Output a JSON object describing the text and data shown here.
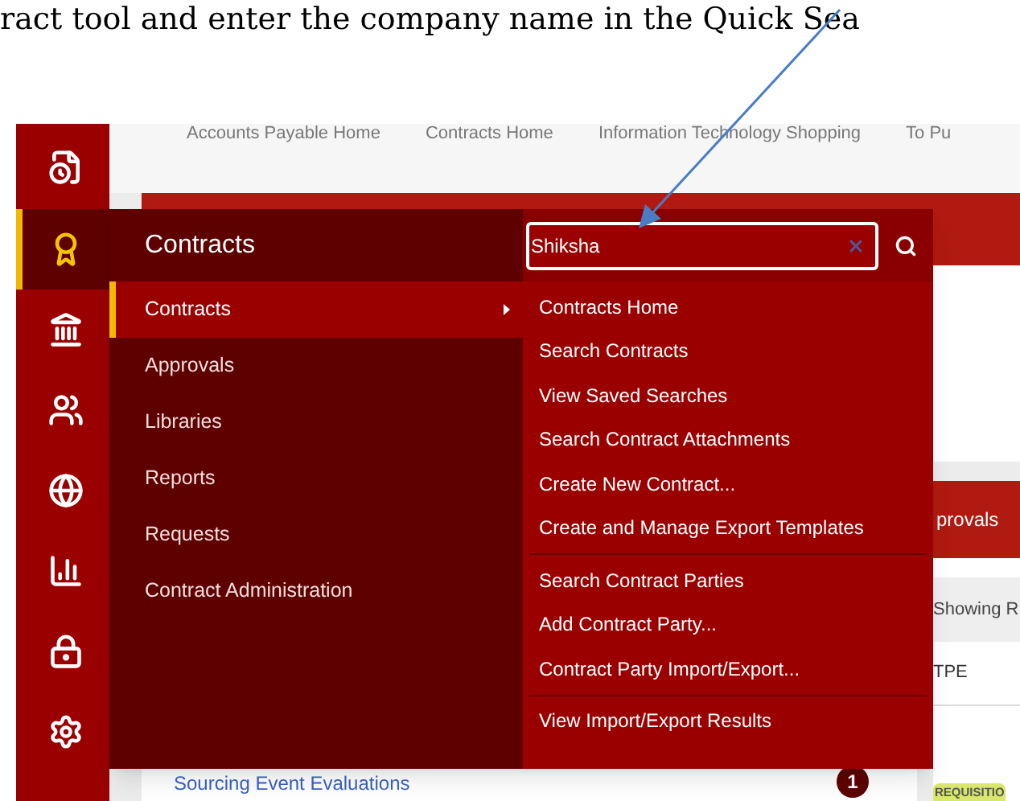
{
  "instruction": "ract tool and enter the company name in the Quick Sea",
  "top_nav": [
    "Accounts Payable Home",
    "Contracts Home",
    "Information Technology Shopping",
    "To Pu"
  ],
  "rail": [
    {
      "kind": "document-clock",
      "selected": false
    },
    {
      "kind": "award",
      "selected": true
    },
    {
      "kind": "bank",
      "selected": false
    },
    {
      "kind": "users",
      "selected": false
    },
    {
      "kind": "globe-search",
      "selected": false
    },
    {
      "kind": "chart",
      "selected": false
    },
    {
      "kind": "lock-gear",
      "selected": false
    },
    {
      "kind": "gear",
      "selected": false
    }
  ],
  "menu": {
    "title": "Contracts",
    "items": [
      {
        "label": "Contracts",
        "selected": true,
        "has_submenu": true
      },
      {
        "label": "Approvals",
        "selected": false,
        "has_submenu": false
      },
      {
        "label": "Libraries",
        "selected": false,
        "has_submenu": false
      },
      {
        "label": "Reports",
        "selected": false,
        "has_submenu": false
      },
      {
        "label": "Requests",
        "selected": false,
        "has_submenu": false
      },
      {
        "label": "Contract Administration",
        "selected": false,
        "has_submenu": false
      }
    ]
  },
  "search": {
    "value": "Shiksha"
  },
  "submenu": [
    [
      "Contracts Home",
      "Search Contracts",
      "View Saved Searches",
      "Search Contract Attachments",
      "Create New Contract...",
      "Create and Manage Export Templates"
    ],
    [
      "Search Contract Parties",
      "Add Contract Party...",
      "Contract Party Import/Export..."
    ],
    [
      "View Import/Export Results"
    ]
  ],
  "background": {
    "approvals_title": "provals",
    "showing": "Showing R",
    "column": "TPE",
    "tag": "REQUISITIO",
    "link": "Sourcing Event Evaluations",
    "count": "1"
  }
}
